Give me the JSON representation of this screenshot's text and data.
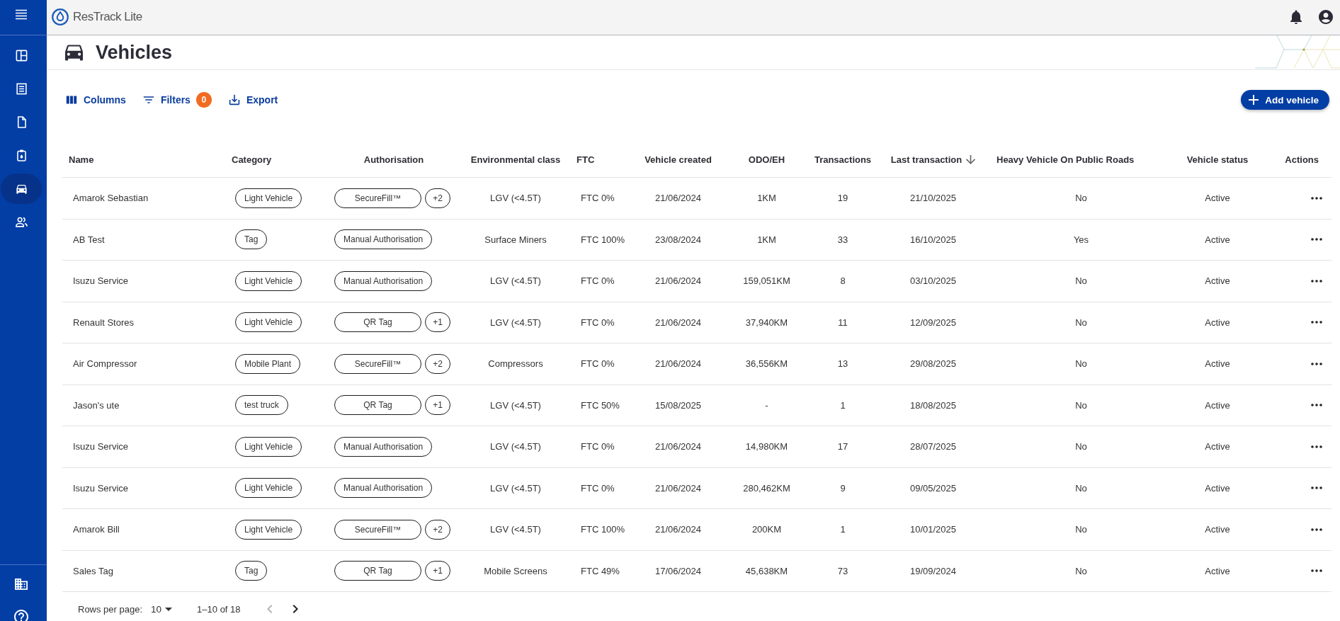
{
  "sidebar": {
    "items": [
      {
        "selected": false
      },
      {
        "selected": false
      },
      {
        "selected": false
      },
      {
        "selected": false
      },
      {
        "selected": true
      },
      {
        "selected": false
      }
    ]
  },
  "top_bar": {
    "app_title": "ResTrack Lite"
  },
  "page": {
    "title": "Vehicles"
  },
  "toolbar": {
    "buttons": [
      {
        "label": "Columns"
      },
      {
        "label": "Filters",
        "badge": "0"
      },
      {
        "label": "Export"
      }
    ],
    "primary_button": {
      "label": "Add vehicle"
    }
  },
  "table": {
    "columns": [
      {
        "label": "Name",
        "sorted": false
      },
      {
        "label": "Category",
        "sorted": false
      },
      {
        "label": "Authorisation",
        "sorted": false
      },
      {
        "label": "Environmental class",
        "sorted": false
      },
      {
        "label": "FTC",
        "sorted": false
      },
      {
        "label": "Vehicle created",
        "sorted": false
      },
      {
        "label": "ODO/EH",
        "sorted": false
      },
      {
        "label": "Transactions",
        "sorted": false
      },
      {
        "label": "Last transaction",
        "sorted": true
      },
      {
        "label": "Heavy Vehicle On Public Roads",
        "sorted": false
      },
      {
        "label": "Vehicle status",
        "sorted": false
      },
      {
        "label": "Actions",
        "sorted": false
      }
    ],
    "rows": [
      {
        "name": "Amarok Sebastian",
        "category": "Light Vehicle",
        "authorisation": {
          "label": "SecureFill™",
          "more": "+2"
        },
        "environmental_class": "LGV (<4.5T)",
        "ftc": "FTC 0%",
        "vehicle_created": "21/06/2024",
        "odo_eh": "1KM",
        "transactions": "19",
        "last_transaction": "21/10/2025",
        "heavy_vehicle_on_public_roads": "No",
        "vehicle_status": "Active"
      },
      {
        "name": "AB Test",
        "category": "Tag",
        "authorisation": {
          "label": "Manual Authorisation"
        },
        "environmental_class": "Surface Miners",
        "ftc": "FTC 100%",
        "vehicle_created": "23/08/2024",
        "odo_eh": "1KM",
        "transactions": "33",
        "last_transaction": "16/10/2025",
        "heavy_vehicle_on_public_roads": "Yes",
        "vehicle_status": "Active"
      },
      {
        "name": "Isuzu Service",
        "category": "Light Vehicle",
        "authorisation": {
          "label": "Manual Authorisation"
        },
        "environmental_class": "LGV (<4.5T)",
        "ftc": "FTC 0%",
        "vehicle_created": "21/06/2024",
        "odo_eh": "159,051KM",
        "transactions": "8",
        "last_transaction": "03/10/2025",
        "heavy_vehicle_on_public_roads": "No",
        "vehicle_status": "Active"
      },
      {
        "name": "Renault Stores",
        "category": "Light Vehicle",
        "authorisation": {
          "label": "QR Tag",
          "more": "+1"
        },
        "environmental_class": "LGV (<4.5T)",
        "ftc": "FTC 0%",
        "vehicle_created": "21/06/2024",
        "odo_eh": "37,940KM",
        "transactions": "11",
        "last_transaction": "12/09/2025",
        "heavy_vehicle_on_public_roads": "No",
        "vehicle_status": "Active"
      },
      {
        "name": "Air Compressor",
        "category": "Mobile Plant",
        "authorisation": {
          "label": "SecureFill™",
          "more": "+2"
        },
        "environmental_class": "Compressors",
        "ftc": "FTC 0%",
        "vehicle_created": "21/06/2024",
        "odo_eh": "36,556KM",
        "transactions": "13",
        "last_transaction": "29/08/2025",
        "heavy_vehicle_on_public_roads": "No",
        "vehicle_status": "Active"
      },
      {
        "name": "Jason's ute",
        "category": "test truck",
        "authorisation": {
          "label": "QR Tag",
          "more": "+1"
        },
        "environmental_class": "LGV (<4.5T)",
        "ftc": "FTC 50%",
        "vehicle_created": "15/08/2025",
        "odo_eh": "-",
        "transactions": "1",
        "last_transaction": "18/08/2025",
        "heavy_vehicle_on_public_roads": "No",
        "vehicle_status": "Active"
      },
      {
        "name": "Isuzu Service",
        "category": "Light Vehicle",
        "authorisation": {
          "label": "Manual Authorisation"
        },
        "environmental_class": "LGV (<4.5T)",
        "ftc": "FTC 0%",
        "vehicle_created": "21/06/2024",
        "odo_eh": "14,980KM",
        "transactions": "17",
        "last_transaction": "28/07/2025",
        "heavy_vehicle_on_public_roads": "No",
        "vehicle_status": "Active"
      },
      {
        "name": "Isuzu Service",
        "category": "Light Vehicle",
        "authorisation": {
          "label": "Manual Authorisation"
        },
        "environmental_class": "LGV (<4.5T)",
        "ftc": "FTC 0%",
        "vehicle_created": "21/06/2024",
        "odo_eh": "280,462KM",
        "transactions": "9",
        "last_transaction": "09/05/2025",
        "heavy_vehicle_on_public_roads": "No",
        "vehicle_status": "Active"
      },
      {
        "name": "Amarok Bill",
        "category": "Light Vehicle",
        "authorisation": {
          "label": "SecureFill™",
          "more": "+2"
        },
        "environmental_class": "LGV (<4.5T)",
        "ftc": "FTC 100%",
        "vehicle_created": "21/06/2024",
        "odo_eh": "200KM",
        "transactions": "1",
        "last_transaction": "10/01/2025",
        "heavy_vehicle_on_public_roads": "No",
        "vehicle_status": "Active"
      },
      {
        "name": "Sales Tag",
        "category": "Tag",
        "authorisation": {
          "label": "QR Tag",
          "more": "+1"
        },
        "environmental_class": "Mobile Screens",
        "ftc": "FTC 49%",
        "vehicle_created": "17/06/2024",
        "odo_eh": "45,638KM",
        "transactions": "73",
        "last_transaction": "19/09/2024",
        "heavy_vehicle_on_public_roads": "No",
        "vehicle_status": "Active"
      }
    ]
  },
  "pagination": {
    "rows_per_page_label": "Rows per page:",
    "rows_per_page": "10",
    "range": "1–10 of 18",
    "previous_disabled": true,
    "next_disabled": false
  }
}
